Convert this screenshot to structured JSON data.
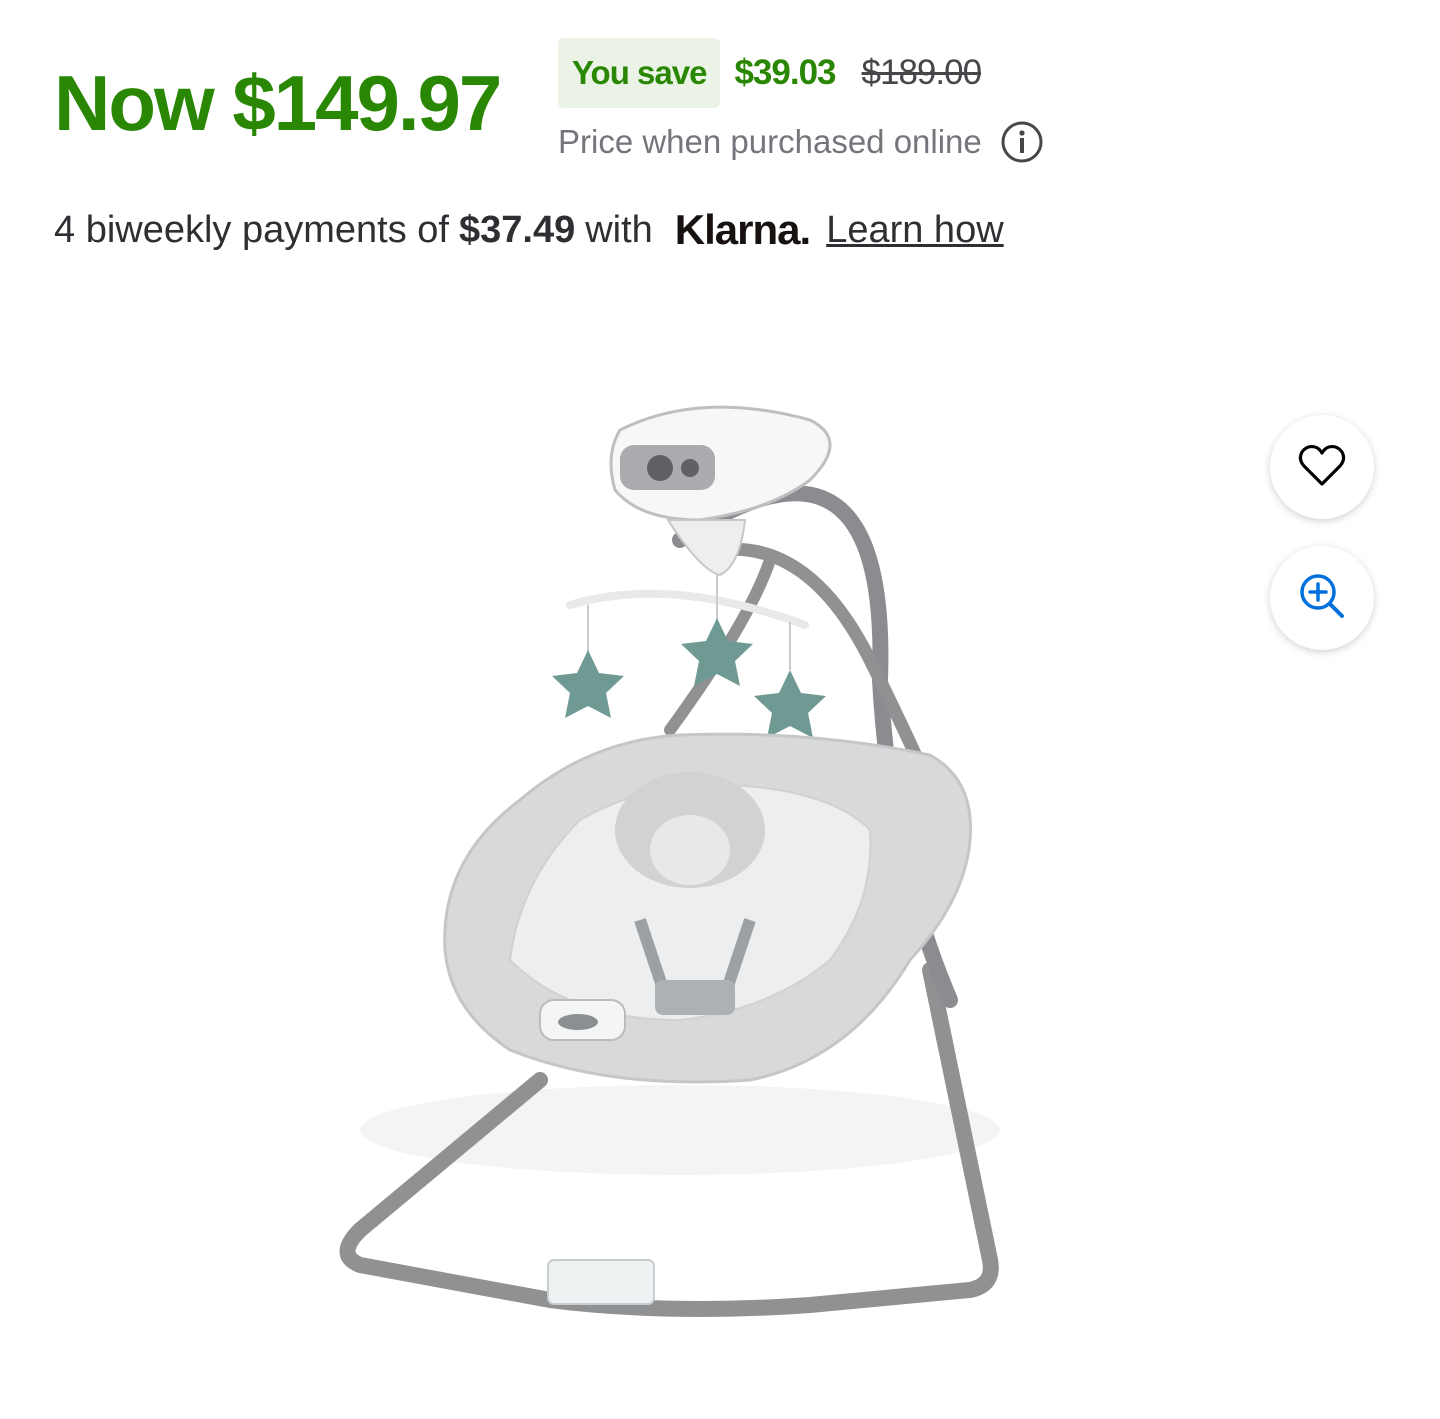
{
  "price": {
    "now_label": "Now $149.97",
    "you_save_label": "You save",
    "save_amount": "$39.03",
    "was_price": "$189.00",
    "online_note": "Price when purchased online"
  },
  "payment": {
    "prefix": "4 biweekly payments of",
    "amount": "$37.49",
    "with": "with",
    "provider": "Klarna.",
    "learn_link": "Learn how"
  },
  "actions": {
    "favorite_icon": "heart-icon",
    "zoom_icon": "zoom-in-icon"
  },
  "colors": {
    "price_green": "#2a8703",
    "badge_bg": "#eaf3e6",
    "zoom_blue": "#0071dc"
  }
}
